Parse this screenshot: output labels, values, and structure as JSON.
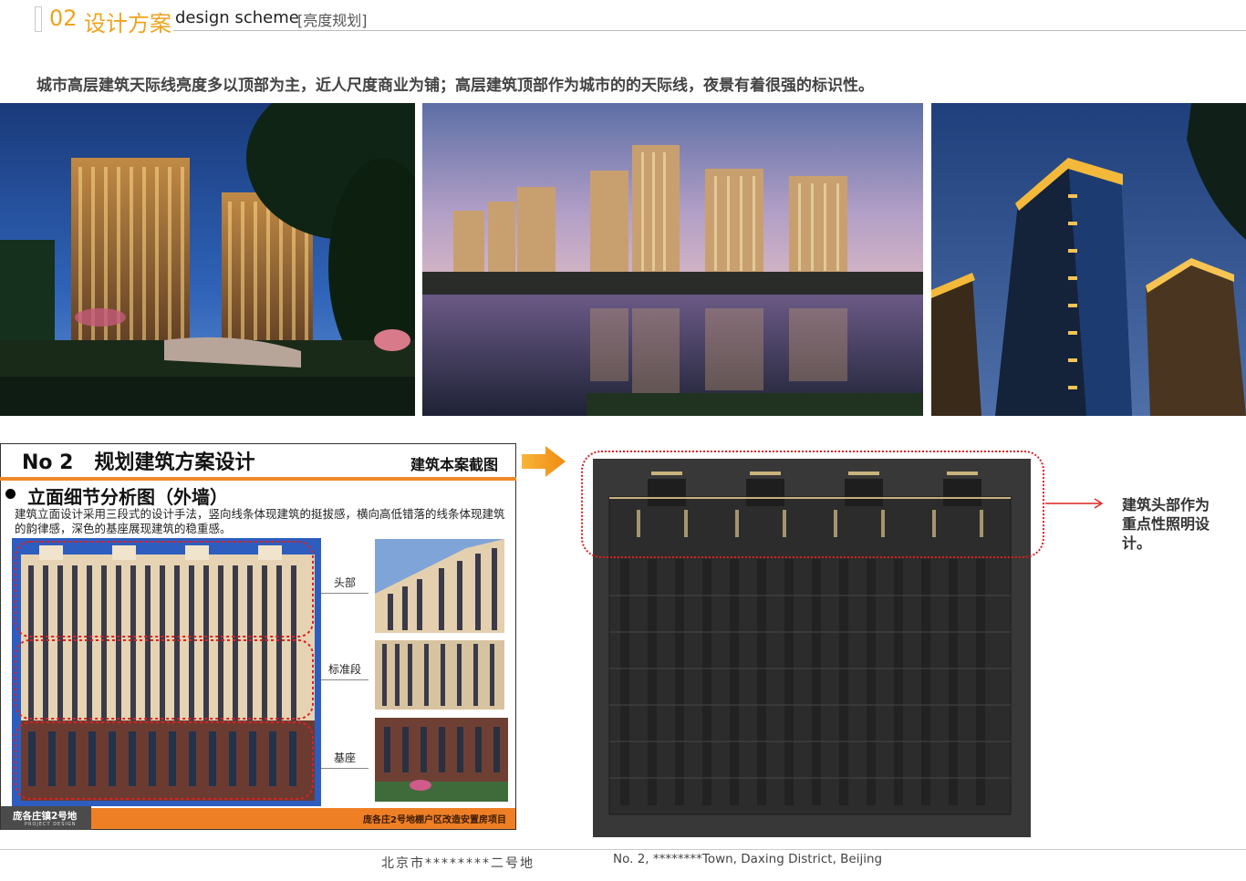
{
  "header": {
    "section_number": "02",
    "section_title_cn": "设计方案",
    "section_title_en": "design scheme",
    "subsection": "[亮度规划]"
  },
  "intro_text": "城市高层建筑天际线亮度多以顶部为主，近人尺度商业为铺；高层建筑顶部作为城市的的天际线，夜景有着很强的标识性。",
  "panel": {
    "number": "No 2",
    "title": "规划建筑方案设计",
    "right_label": "建筑本案截图",
    "elevation_title": "立面细节分析图（外墙）",
    "description": "建筑立面设计采用三段式的设计手法，竖向线条体现建筑的挺拔感，横向高低错落的线条体现建筑的韵律感，深色的基座展现建筑的稳重感。",
    "segments": [
      {
        "label": "头部"
      },
      {
        "label": "标准段"
      },
      {
        "label": "基座"
      }
    ],
    "footer_left": "庞各庄镇2号地",
    "footer_left_sub": "PROJECT DESIGN",
    "footer_right": "庞各庄2号地棚户区改造安置房项目"
  },
  "callout": "建筑头部作为重点性照明设计。",
  "footer": {
    "cn": "北京市********二号地",
    "en": "No. 2, ********Town, Daxing District, Beijing"
  },
  "colors": {
    "accent_orange": "#f0a31c",
    "rule_orange": "#ee8a2a",
    "highlight_red": "#e02020"
  }
}
